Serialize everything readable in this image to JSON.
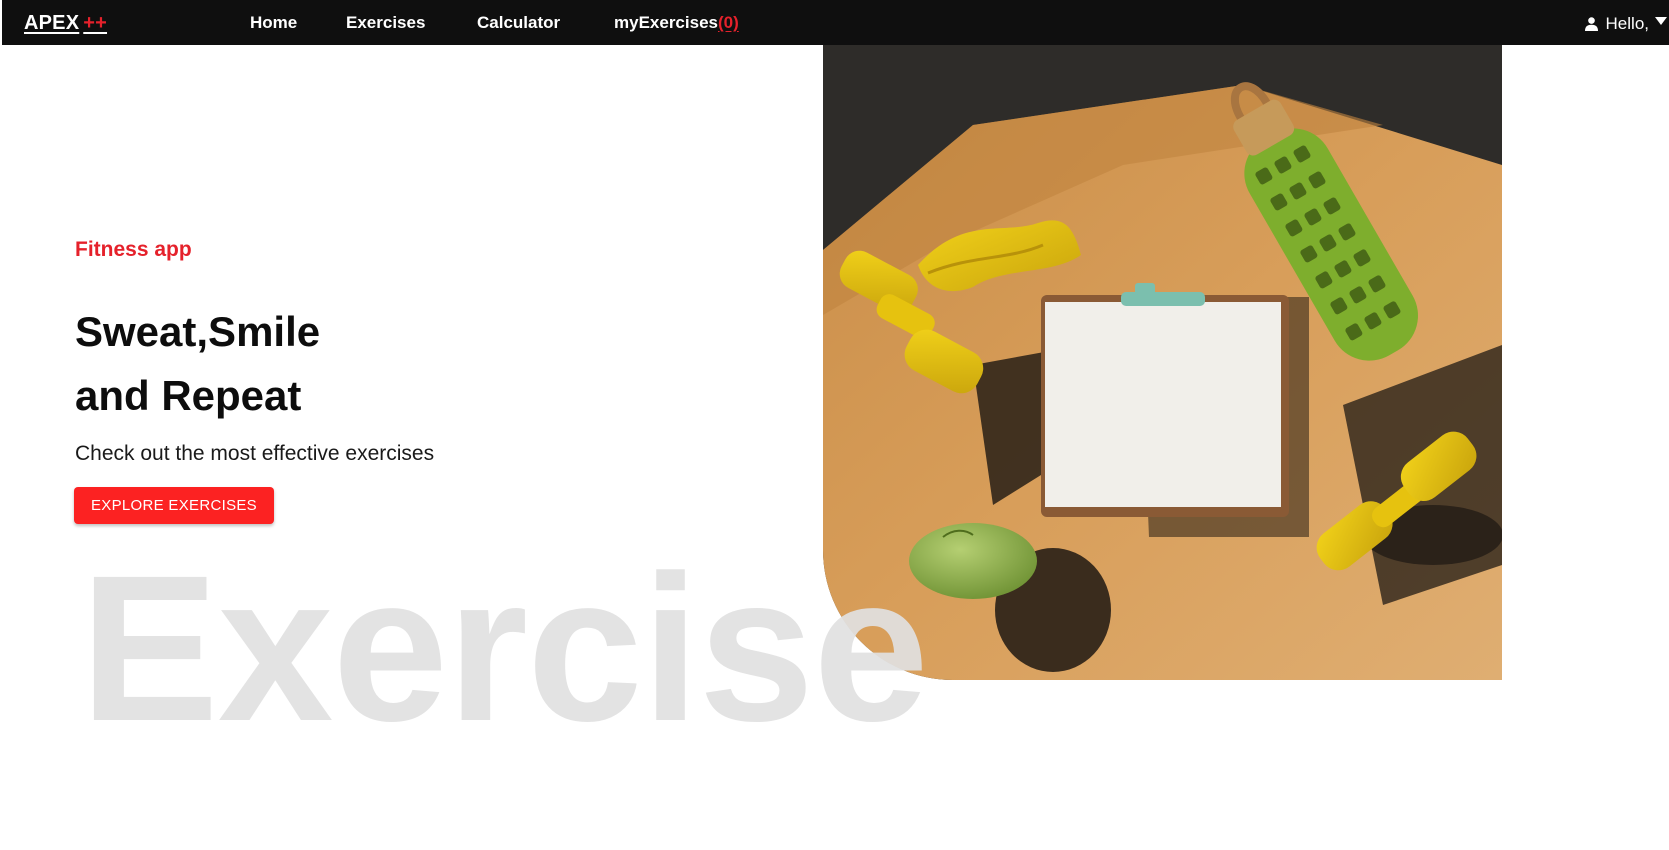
{
  "nav": {
    "brand": "APEX",
    "brand_suffix": "++",
    "links": [
      {
        "label": "Home"
      },
      {
        "label": "Exercises"
      },
      {
        "label": "Calculator"
      },
      {
        "label": "myExercises",
        "count": "(0)"
      }
    ],
    "user_greeting": "Hello,"
  },
  "hero": {
    "eyebrow": "Fitness app",
    "headline_line1": "Sweat,Smile",
    "headline_line2": "and Repeat",
    "subtitle": "Check out the most effective exercises",
    "cta_label": "EXPLORE EXERCISES",
    "background_word": "Exercise"
  },
  "colors": {
    "accent": "#FC2222",
    "navbar": "#0F0F0F",
    "watermark": "#E1E1E1"
  },
  "icons": [
    "user-icon",
    "caret-down-icon"
  ]
}
